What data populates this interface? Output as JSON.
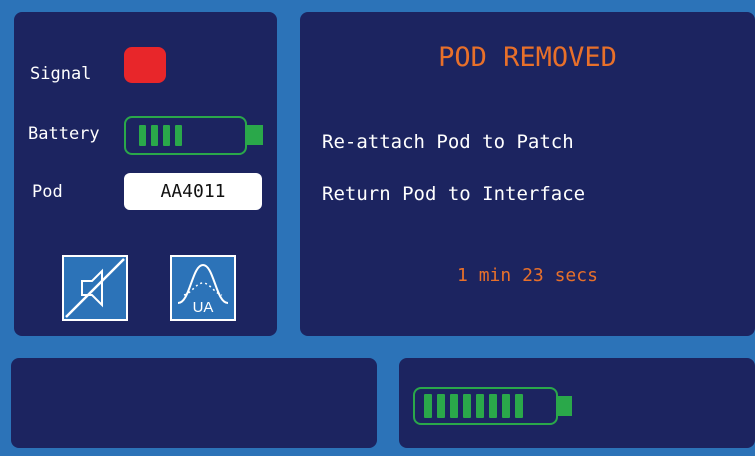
{
  "status": {
    "signal_label": "Signal",
    "signal_color": "#e8262a",
    "battery_label": "Battery",
    "battery_level": 0.5,
    "pod_label": "Pod",
    "pod_id": "AA4011"
  },
  "controls": {
    "mute_icon": "speaker-muted-icon",
    "ua_icon": "uterine-activity-icon",
    "ua_label": "UA"
  },
  "alert": {
    "title": "POD REMOVED",
    "instructions": [
      "Re-attach Pod to Patch",
      "Return Pod to Interface"
    ],
    "timer": "1 min 23 secs"
  },
  "footer": {
    "battery_level": 1.0
  },
  "colors": {
    "background": "#2c73b8",
    "panel": "#1c2460",
    "accent_orange": "#e8702a",
    "battery_green": "#2aa84a"
  }
}
